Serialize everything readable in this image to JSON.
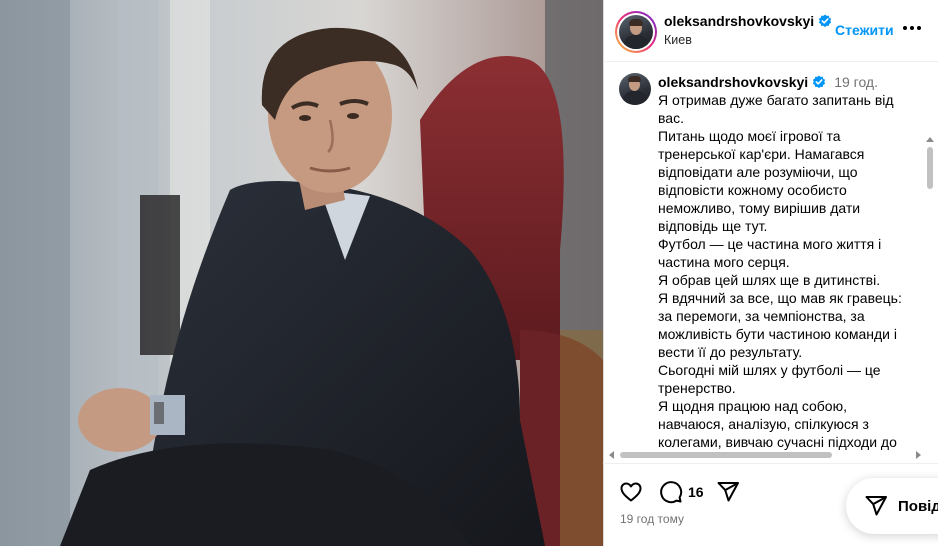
{
  "post": {
    "username": "oleksandrshovkovskyi",
    "location": "Киев",
    "follow_label": "Стежити",
    "photo_alt": "photo",
    "more_icon": "more-horizontal-icon"
  },
  "caption": {
    "username": "oleksandrshovkovskyi",
    "time": "19 год.",
    "lines": [
      "Я отримав дуже багато запитань від вас.",
      "Питань щодо моєї ігрової та тренерської кар'єри. Намагався відповідати але розуміючи, що відповісти кожному особисто неможливо, тому вирішив дати відповідь ще тут.",
      "Футбол — це частина мого життя і частина мого серця.",
      "Я обрав цей шлях ще в дитинстві.",
      "Я вдячний за все, що мав як гравець: за перемоги, за чемпіонства, за можливість бути частиною команди і вести її до результату.",
      "Сьогодні мій шлях у футболі — це тренерство.",
      "Я щодня працюю над собою, навчаюся, аналізую, спілкуюся з колегами, вивчаю сучасні підходи до"
    ]
  },
  "actions": {
    "like_icon": "heart-icon",
    "comment_icon": "comment-icon",
    "comment_count": "16",
    "share_icon": "send-icon",
    "posted_time": "19 год тому"
  },
  "share_popup": {
    "label": "Повід"
  },
  "colors": {
    "link_blue": "#0095f6",
    "verified_blue": "#0095f6",
    "muted_text": "#737373"
  }
}
